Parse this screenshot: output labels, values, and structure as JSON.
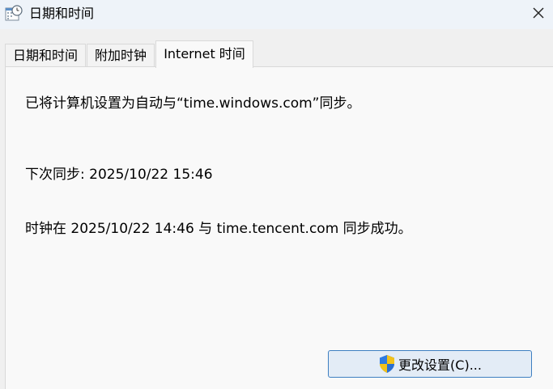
{
  "window": {
    "title": "日期和时间",
    "title_icon": "calendar-clock-icon",
    "close_icon": "close-icon"
  },
  "tabs": [
    {
      "label": "日期和时间",
      "active": false
    },
    {
      "label": "附加时钟",
      "active": false
    },
    {
      "label": "Internet 时间",
      "active": true
    }
  ],
  "internet_time": {
    "sync_setting": "已将计算机设置为自动与“time.windows.com”同步。",
    "next_sync": "下次同步: 2025/10/22 15:46",
    "last_sync": "时钟在 2025/10/22 14:46 与 time.tencent.com 同步成功。",
    "change_button_label": "更改设置(C)...",
    "change_button_icon": "uac-shield-icon"
  },
  "colors": {
    "titlebar_bg": "#eef3f9",
    "panel_bg": "#f9f9f9",
    "window_bg": "#f0f0f0",
    "button_bg": "#e3ecf6",
    "button_border": "#3e7fc1"
  }
}
